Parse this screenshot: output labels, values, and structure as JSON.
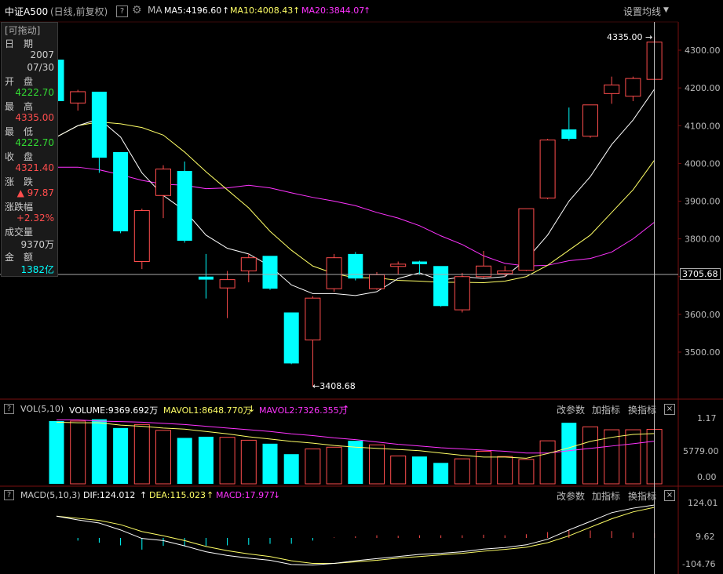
{
  "header": {
    "symbol": "中证A500",
    "mode": "(日线,前复权)",
    "help": "?",
    "ma_label": "MA",
    "ma5": "MA5:4196.60",
    "ma10": "MA10:4008.43",
    "ma20": "MA20:3844.07",
    "settings": "设置均线",
    "arrow_up": "↑"
  },
  "colors": {
    "up": "#ff4d4d",
    "down": "#00ffff",
    "ma5": "#ffffff",
    "ma10": "#ffff66",
    "ma20": "#ff33ff",
    "green": "#33dd33"
  },
  "info": {
    "drag": "[可拖动]",
    "date_label": "日　期",
    "date_year": "2007",
    "date_md": "07/30",
    "open_label": "开　盘",
    "open": "4222.70",
    "high_label": "最　高",
    "high": "4335.00",
    "low_label": "最　低",
    "low": "4222.70",
    "close_label": "收　盘",
    "close": "4321.40",
    "change_label": "涨　跌",
    "change": "▲ 97.87",
    "pct_label": "涨跌幅",
    "pct": "+2.32%",
    "vol_label": "成交量",
    "vol": "9370万",
    "amt_label": "金　额",
    "amt": "1382亿"
  },
  "annotations": {
    "high_mark": "4335.00",
    "low_mark": "3408.68",
    "current_price": "3705.68"
  },
  "price_axis": {
    "ticks": [
      "4300.00",
      "4200.00",
      "4100.00",
      "4000.00",
      "3900.00",
      "3800.00",
      "3700.00",
      "3600.00",
      "3500.00"
    ],
    "values": [
      4300,
      4200,
      4100,
      4000,
      3900,
      3800,
      3700,
      3600,
      3500
    ]
  },
  "volume_panel": {
    "collapse": "?",
    "title": "VOL(5,10)",
    "volume": "VOLUME:9369.692万",
    "mavol1": "MAVOL1:8648.770万",
    "mavol2": "MAVOL2:7326.355万",
    "down_arrow": "↓",
    "up_arrow": "↑",
    "btn_params": "改参数",
    "btn_add": "加指标",
    "btn_switch": "换指标",
    "close": "×",
    "axis": [
      "1.17",
      "5779.00",
      "0.00"
    ],
    "axis_unit_hint": ""
  },
  "macd_panel": {
    "collapse": "?",
    "title": "MACD(5,10,3)",
    "dif": "DIF:124.012",
    "dea": "DEA:115.023",
    "macd": "MACD:17.977",
    "down_arrow": "↓",
    "up_arrow": "↑",
    "btn_params": "改参数",
    "btn_add": "加指标",
    "btn_switch": "换指标",
    "close": "×",
    "axis": [
      "124.01",
      "9.62",
      "-104.76"
    ]
  },
  "chart_data": {
    "type": "candlestick",
    "y_range": [
      3380,
      4370
    ],
    "candles": [
      {
        "o": 4275,
        "h": 4280,
        "l": 4160,
        "c": 4165
      },
      {
        "o": 4160,
        "h": 4195,
        "l": 4140,
        "c": 4190
      },
      {
        "o": 4190,
        "h": 4190,
        "l": 3975,
        "c": 4015
      },
      {
        "o": 4030,
        "h": 4030,
        "l": 3815,
        "c": 3820
      },
      {
        "o": 3740,
        "h": 3880,
        "l": 3720,
        "c": 3875
      },
      {
        "o": 3915,
        "h": 3995,
        "l": 3855,
        "c": 3985
      },
      {
        "o": 3980,
        "h": 4005,
        "l": 3790,
        "c": 3795
      },
      {
        "o": 3700,
        "h": 3760,
        "l": 3642,
        "c": 3692
      },
      {
        "o": 3670,
        "h": 3715,
        "l": 3590,
        "c": 3692
      },
      {
        "o": 3715,
        "h": 3760,
        "l": 3685,
        "c": 3750
      },
      {
        "o": 3755,
        "h": 3755,
        "l": 3665,
        "c": 3668
      },
      {
        "o": 3605,
        "h": 3605,
        "l": 3468,
        "c": 3470
      },
      {
        "o": 3532,
        "h": 3648,
        "l": 3408.68,
        "c": 3643
      },
      {
        "o": 3668,
        "h": 3760,
        "l": 3660,
        "c": 3750
      },
      {
        "o": 3760,
        "h": 3765,
        "l": 3690,
        "c": 3695
      },
      {
        "o": 3668,
        "h": 3712,
        "l": 3665,
        "c": 3705
      },
      {
        "o": 3727,
        "h": 3740,
        "l": 3705,
        "c": 3733
      },
      {
        "o": 3740,
        "h": 3742,
        "l": 3705,
        "c": 3733
      },
      {
        "o": 3728,
        "h": 3728,
        "l": 3620,
        "c": 3622
      },
      {
        "o": 3612,
        "h": 3710,
        "l": 3605,
        "c": 3700
      },
      {
        "o": 3700,
        "h": 3768,
        "l": 3695,
        "c": 3728
      },
      {
        "o": 3708,
        "h": 3728,
        "l": 3700,
        "c": 3715
      },
      {
        "o": 3717,
        "h": 3880,
        "l": 3715,
        "c": 3880
      },
      {
        "o": 3908,
        "h": 4065,
        "l": 3905,
        "c": 4062
      },
      {
        "o": 4090,
        "h": 4148,
        "l": 4060,
        "c": 4065
      },
      {
        "o": 4072,
        "h": 4155,
        "l": 4068,
        "c": 4155
      },
      {
        "o": 4185,
        "h": 4230,
        "l": 4158,
        "c": 4208
      },
      {
        "o": 4178,
        "h": 4230,
        "l": 4165,
        "c": 4225
      },
      {
        "o": 4222.7,
        "h": 4335,
        "l": 4222.7,
        "c": 4321.4
      }
    ],
    "ma5": [
      4070,
      4100,
      4118,
      4070,
      3975,
      3915,
      3875,
      3810,
      3775,
      3760,
      3728,
      3678,
      3655,
      3655,
      3650,
      3660,
      3695,
      3710,
      3690,
      3700,
      3695,
      3700,
      3745,
      3810,
      3900,
      3965,
      4050,
      4115,
      4196.6
    ],
    "ma10": [
      4070,
      4100,
      4110,
      4105,
      4095,
      4075,
      4030,
      3978,
      3930,
      3882,
      3820,
      3770,
      3728,
      3708,
      3697,
      3697,
      3690,
      3688,
      3685,
      3685,
      3684,
      3688,
      3700,
      3730,
      3770,
      3810,
      3870,
      3930,
      4008.4
    ],
    "ma20": [
      3990,
      3990,
      3983,
      3970,
      3955,
      3945,
      3942,
      3933,
      3935,
      3942,
      3935,
      3922,
      3910,
      3900,
      3888,
      3870,
      3855,
      3835,
      3808,
      3785,
      3755,
      3735,
      3728,
      3730,
      3742,
      3748,
      3765,
      3800,
      3844.1
    ],
    "volumes": [
      10.8,
      10.8,
      11.1,
      9.6,
      10.2,
      9.2,
      7.9,
      8.1,
      8.0,
      7.5,
      6.9,
      5.1,
      6.0,
      6.3,
      7.4,
      6.7,
      4.8,
      4.7,
      3.6,
      4.3,
      5.6,
      4.7,
      4.2,
      7.4,
      10.5,
      9.8,
      9.3,
      9.3,
      9.37
    ],
    "mavol1": [
      10.6,
      10.5,
      10.5,
      10.1,
      9.9,
      9.6,
      9.4,
      9.0,
      8.6,
      8.1,
      7.7,
      7.3,
      7.0,
      6.6,
      6.3,
      6.1,
      5.9,
      5.7,
      5.3,
      4.9,
      4.6,
      4.6,
      4.4,
      5.2,
      6.2,
      7.3,
      8.0,
      8.5,
      8.65
    ],
    "mavol2": [
      11.0,
      11.0,
      10.8,
      10.7,
      10.6,
      10.4,
      10.2,
      9.9,
      9.6,
      9.3,
      9.0,
      8.6,
      8.3,
      7.9,
      7.6,
      7.2,
      6.8,
      6.5,
      6.2,
      6.0,
      5.8,
      5.6,
      5.3,
      5.3,
      5.7,
      6.1,
      6.5,
      6.9,
      7.33
    ],
    "dif": [
      82,
      68,
      56,
      30,
      -2,
      -10,
      -30,
      -52,
      -66,
      -76,
      -84,
      -100,
      -102,
      -96,
      -86,
      -78,
      -70,
      -62,
      -58,
      -52,
      -42,
      -36,
      -26,
      -5,
      30,
      62,
      95,
      112,
      124
    ],
    "dea": [
      82,
      74,
      66,
      50,
      24,
      8,
      -10,
      -32,
      -48,
      -60,
      -70,
      -86,
      -96,
      -96,
      -90,
      -84,
      -76,
      -70,
      -64,
      -58,
      -50,
      -43,
      -35,
      -18,
      8,
      40,
      72,
      98,
      115
    ],
    "macd": [
      0,
      -10,
      -18,
      -28,
      -44,
      -30,
      -32,
      -30,
      -28,
      -26,
      -22,
      -22,
      -10,
      2,
      6,
      10,
      8,
      10,
      10,
      10,
      12,
      10,
      14,
      22,
      30,
      28,
      26,
      20,
      18
    ]
  }
}
